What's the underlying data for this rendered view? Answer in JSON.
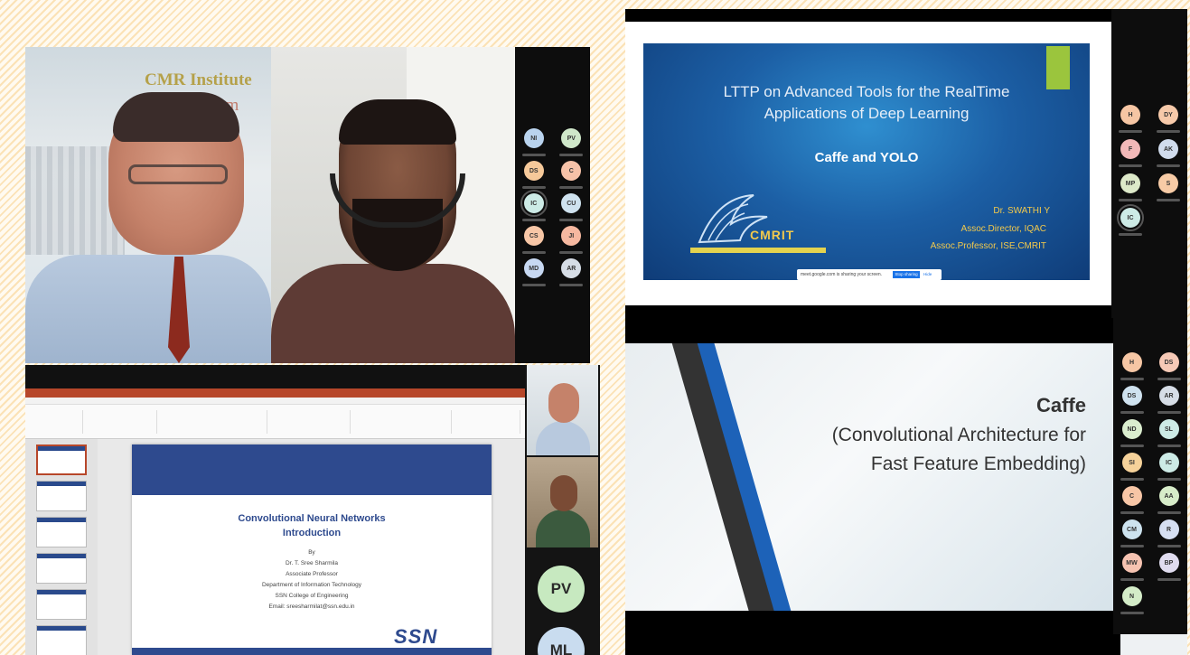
{
  "panel_a": {
    "banner_line1": "CMR Institute",
    "banner_line2": "partm",
    "participants": [
      {
        "initials": "NI",
        "color": "#b9d3ee"
      },
      {
        "initials": "PV",
        "color": "#cfe7c9"
      },
      {
        "initials": "DS",
        "color": "#f6c99a"
      },
      {
        "initials": "C",
        "color": "#f7c2a8"
      },
      {
        "initials": "IC",
        "color": "#cdebe6",
        "selected": true
      },
      {
        "initials": "CU",
        "color": "#cfe2ef"
      },
      {
        "initials": "CS",
        "color": "#f7c6a6"
      },
      {
        "initials": "JI",
        "color": "#f6b8a0"
      },
      {
        "initials": "MD",
        "color": "#c7d8f2"
      },
      {
        "initials": "AR",
        "color": "#d6dde6"
      }
    ]
  },
  "panel_b": {
    "slide_title_1": "Convolutional Neural Networks",
    "slide_title_2": "Introduction",
    "lines": [
      "By",
      "Dr. T. Sree Sharmila",
      "Associate Professor",
      "Department of Information Technology",
      "SSN College of Engineering",
      "Email: sreesharmilat@ssn.edu.in"
    ],
    "logo_text": "SSN",
    "big_avatars": [
      {
        "initials": "PV",
        "color": "#c7e9c0"
      },
      {
        "initials": "ML",
        "color": "#c9dcef"
      }
    ],
    "thumb_numbers": [
      "1",
      "2",
      "3",
      "4",
      "5",
      "6"
    ]
  },
  "panel_c": {
    "title_line1": "LTTP on Advanced Tools for the RealTime",
    "title_line2": "Applications of Deep Learning",
    "subtitle": "Caffe and YOLO",
    "logo_text": "CMRIT",
    "presenter": "Dr. SWATHI Y",
    "designation_1": "Assoc.Director, IQAC",
    "designation_2": "Assoc.Professor, ISE,CMRIT",
    "share_message": "meet.google.com is sharing your screen.",
    "stop_sharing": "Stop sharing",
    "hide": "Hide",
    "participants": [
      {
        "initials": "H",
        "color": "#f6c6a4"
      },
      {
        "initials": "DY",
        "color": "#f6c9a9"
      },
      {
        "initials": "F",
        "color": "#f2b8b8"
      },
      {
        "initials": "AK",
        "color": "#d1dced"
      },
      {
        "initials": "MP",
        "color": "#dde9c9"
      },
      {
        "initials": "S",
        "color": "#f7cba6"
      },
      {
        "initials": "IC",
        "color": "#cdebe6",
        "selected": true
      }
    ]
  },
  "panel_d": {
    "title": "Caffe",
    "line1": "(Convolutional Architecture for",
    "line2": "Fast Feature Embedding)",
    "participants": [
      {
        "initials": "H",
        "color": "#f6c6a4"
      },
      {
        "initials": "DS",
        "color": "#f6c9b6"
      },
      {
        "initials": "DS",
        "color": "#cfe2ef"
      },
      {
        "initials": "AR",
        "color": "#d6dde6"
      },
      {
        "initials": "ND",
        "color": "#dbeecf"
      },
      {
        "initials": "SL",
        "color": "#cdebe6"
      },
      {
        "initials": "SI",
        "color": "#f6d29a"
      },
      {
        "initials": "IC",
        "color": "#cdebe6"
      },
      {
        "initials": "C",
        "color": "#f7c6a6"
      },
      {
        "initials": "AA",
        "color": "#d7ecc9"
      },
      {
        "initials": "CM",
        "color": "#cde3ef"
      },
      {
        "initials": "R",
        "color": "#d6dff2"
      },
      {
        "initials": "MW",
        "color": "#f6c3b1"
      },
      {
        "initials": "BP",
        "color": "#e0dcef"
      },
      {
        "initials": "N",
        "color": "#d4ecc8"
      }
    ]
  }
}
